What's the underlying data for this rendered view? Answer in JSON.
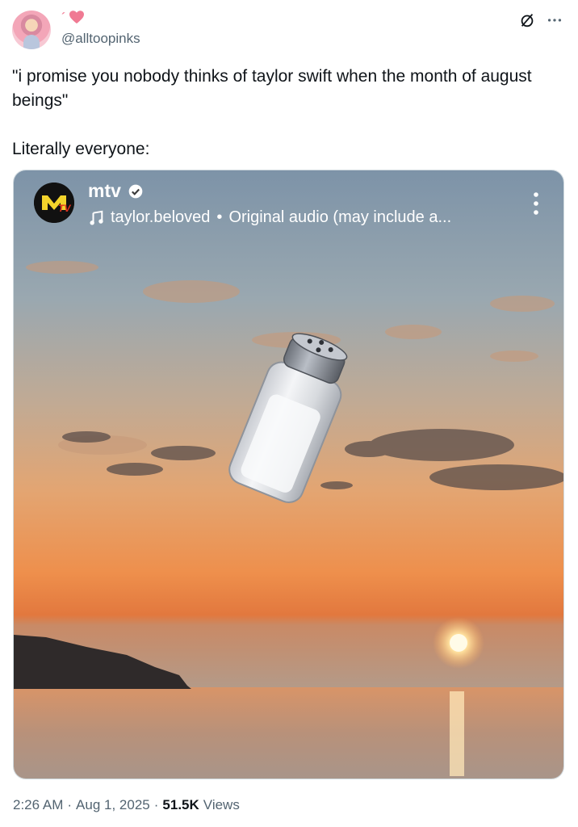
{
  "author": {
    "display_name": "´",
    "handle": "@alltoopinks"
  },
  "header": {
    "grok_icon": "slashed-circle-icon",
    "more_icon": "more-dots-icon"
  },
  "tweet": {
    "text_line1": "\"i promise you nobody thinks of taylor swift when the month of august beings\"",
    "text_line2": "Literally everyone:"
  },
  "media": {
    "account_name": "mtv",
    "audio_user": "taylor.beloved",
    "audio_separator": "•",
    "audio_desc": "Original audio (may include a...",
    "logo_text": "M",
    "logo_sub": "TV",
    "icons": [
      "mtv-logo-icon",
      "verified-badge-icon",
      "music-note-icon",
      "vertical-dots-icon",
      "salt-shaker-icon"
    ]
  },
  "footer": {
    "time": "2:26 AM",
    "sep1": "·",
    "date": "Aug 1, 2025",
    "sep2": "·",
    "views_count": "51.5K",
    "views_label": "Views"
  },
  "colors": {
    "name_pink": "#f27c94",
    "text": "#0f1419",
    "muted": "#536471",
    "mtv_yellow": "#f2d32b"
  }
}
